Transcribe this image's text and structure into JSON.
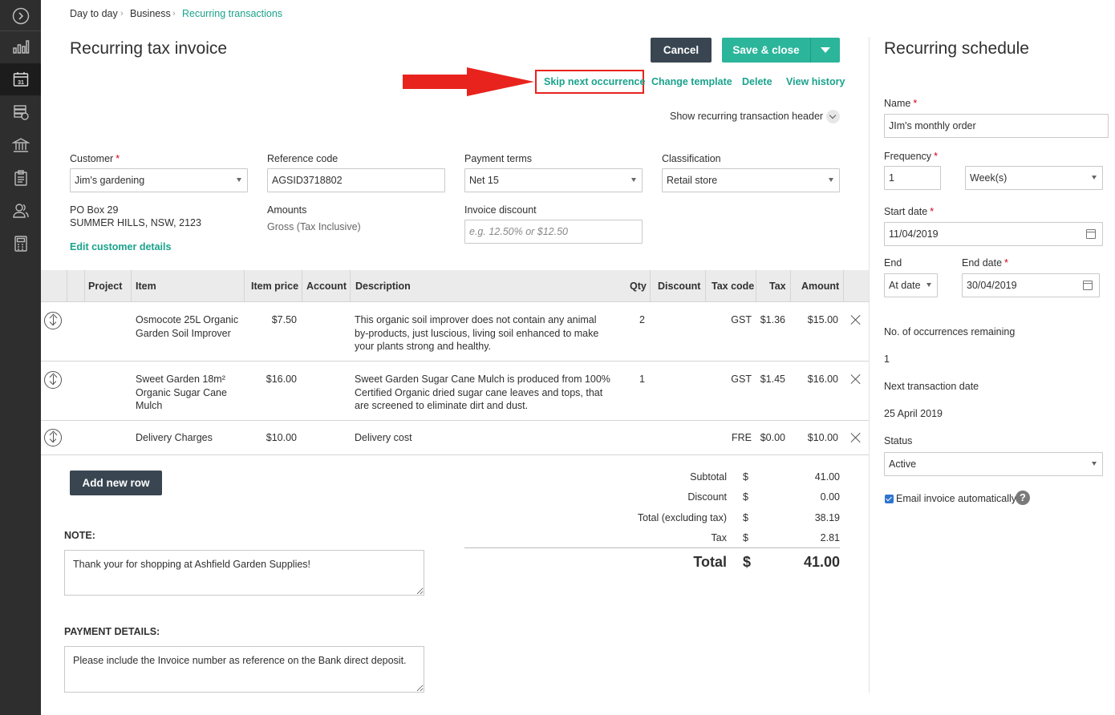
{
  "breadcrumb": {
    "items": [
      "Day to day",
      "Business",
      "Recurring transactions"
    ]
  },
  "page_title": "Recurring tax invoice",
  "toolbar": {
    "cancel_label": "Cancel",
    "save_close_label": "Save & close"
  },
  "actions": {
    "skip": "Skip next occurrence",
    "change_template": "Change template",
    "delete": "Delete",
    "view_history": "View history"
  },
  "show_header_label": "Show recurring transaction header",
  "form": {
    "customer": {
      "label": "Customer",
      "value": "Jim's gardening"
    },
    "reference": {
      "label": "Reference code",
      "value": "AGSID3718802"
    },
    "payment_terms": {
      "label": "Payment terms",
      "value": "Net 15"
    },
    "classification": {
      "label": "Classification",
      "value": "Retail store"
    },
    "address": {
      "line1": "PO Box 29",
      "line2": "SUMMER HILLS, NSW, 2123"
    },
    "amounts": {
      "label": "Amounts",
      "value": "Gross (Tax Inclusive)"
    },
    "invoice_discount": {
      "label": "Invoice discount",
      "placeholder": "e.g. 12.50% or $12.50"
    },
    "edit_customer": "Edit customer details"
  },
  "table": {
    "headers": {
      "project": "Project",
      "item": "Item",
      "item_price": "Item price",
      "account": "Account",
      "description": "Description",
      "qty": "Qty",
      "discount": "Discount",
      "tax_code": "Tax code",
      "tax": "Tax",
      "amount": "Amount"
    },
    "rows": [
      {
        "item": [
          "Osmocote 25L Organic",
          "Garden Soil Improver"
        ],
        "price": "$7.50",
        "description": [
          "This organic soil improver does not contain any animal",
          "by-products, just luscious, living soil enhanced to make",
          "your plants strong and healthy."
        ],
        "qty": "2",
        "tax_code": "GST",
        "tax": "$1.36",
        "amount": "$15.00"
      },
      {
        "item": [
          "Sweet Garden 18m²",
          "Organic Sugar Cane",
          "Mulch"
        ],
        "price": "$16.00",
        "description": [
          "Sweet Garden Sugar Cane Mulch is produced from 100%",
          "Certified Organic dried sugar cane leaves and tops, that",
          "are screened to eliminate dirt and dust."
        ],
        "qty": "1",
        "tax_code": "GST",
        "tax": "$1.45",
        "amount": "$16.00"
      },
      {
        "item": [
          "Delivery Charges"
        ],
        "price": "$10.00",
        "description": [
          "Delivery cost"
        ],
        "qty": "",
        "tax_code": "FRE",
        "tax": "$0.00",
        "amount": "$10.00"
      }
    ]
  },
  "add_row_label": "Add new row",
  "totals": {
    "currency": "$",
    "subtotal": {
      "label": "Subtotal",
      "value": "41.00"
    },
    "discount": {
      "label": "Discount",
      "value": "0.00"
    },
    "total_ex": {
      "label": "Total (excluding tax)",
      "value": "38.19"
    },
    "tax": {
      "label": "Tax",
      "value": "2.81"
    },
    "total": {
      "label": "Total",
      "value": "41.00"
    }
  },
  "note": {
    "label": "NOTE:",
    "value": "Thank your for shopping at Ashfield Garden Supplies!"
  },
  "payment_details": {
    "label": "PAYMENT DETAILS:",
    "value": "Please include the Invoice number as reference on the Bank direct deposit."
  },
  "schedule": {
    "title": "Recurring schedule",
    "name": {
      "label": "Name",
      "value": "JIm's monthly order"
    },
    "frequency": {
      "label": "Frequency",
      "value": "1",
      "unit": "Week(s)"
    },
    "start_date": {
      "label": "Start date",
      "value": "11/04/2019"
    },
    "end": {
      "label": "End",
      "value": "At date"
    },
    "end_date": {
      "label": "End date",
      "value": "30/04/2019"
    },
    "occurrences": {
      "label": "No. of occurrences remaining",
      "value": "1"
    },
    "next_date": {
      "label": "Next transaction date",
      "value": "25 April 2019"
    },
    "status": {
      "label": "Status",
      "value": "Active"
    },
    "email_auto": {
      "label": "Email invoice automatically"
    }
  },
  "colors": {
    "accent": "#1aa38c",
    "save": "#2bb59a",
    "cancel": "#394651",
    "highlight": "#e8231d"
  }
}
